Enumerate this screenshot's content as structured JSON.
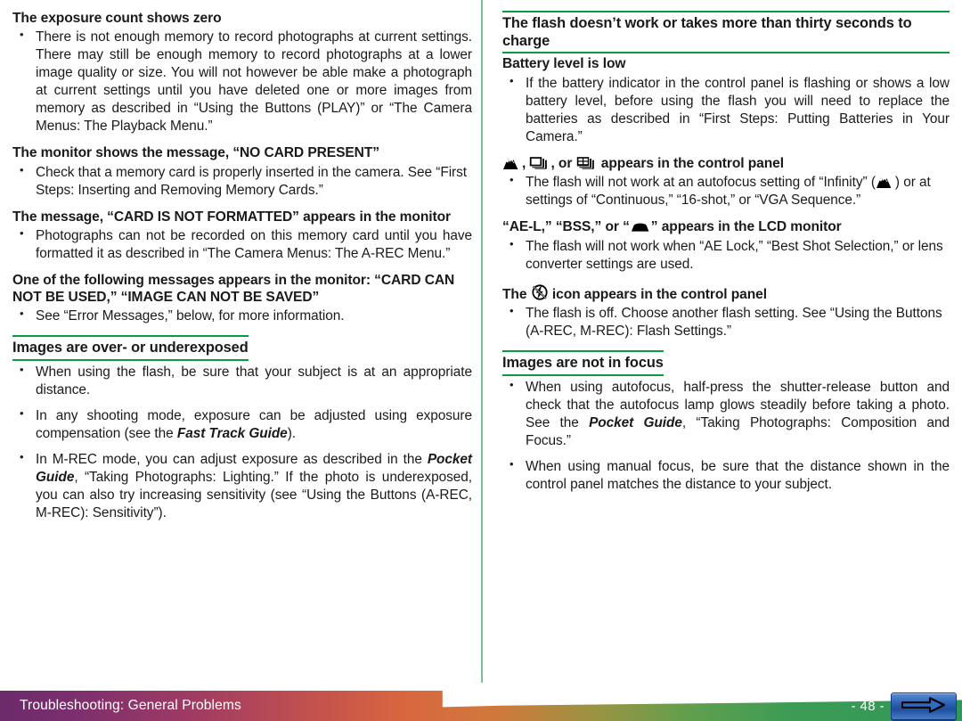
{
  "page": {
    "number_label": "- 48 -",
    "footer_title": "Troubleshooting: General Problems",
    "accent_green": "#0a9a3f",
    "divider_green": "#7fbf92"
  },
  "left_column": {
    "sections": [
      {
        "heading": "The exposure count shows zero",
        "heading_style": "plain",
        "bullets": [
          "There is not enough memory to record photographs at current settings. There may still be enough memory to record photographs at a lower image quality or size.  You will not however be able make a photograph at current settings until you have deleted one or more images from memory as described in “Using the Buttons (PLAY)” or “The Camera Menus: The Playback Menu.”"
        ]
      },
      {
        "heading": "The monitor shows the message, “NO CARD PRESENT”",
        "heading_style": "plain",
        "bullets": [
          "Check that a memory card is properly inserted in the camera. See “First Steps: Inserting and Removing Memory Cards.”"
        ]
      },
      {
        "heading": "The message, “CARD IS NOT FORMATTED” appears in the monitor",
        "heading_style": "plain",
        "bullets": [
          "Photographs can not be recorded on this memory card until you have formatted it as described in “The Camera Menus: The A-REC Menu.”"
        ]
      },
      {
        "heading": "One of the following messages appears in the monitor: “CARD CAN NOT BE USED,” “IMAGE CAN NOT BE SAVED”",
        "heading_style": "plain",
        "bullets": [
          "See “Error Messages,” below, for more information."
        ]
      },
      {
        "heading": "Images are over- or underexposed",
        "heading_style": "major",
        "bullets": [
          "When using the flash, be sure that your subject is at an appropriate distance.",
          "In any shooting mode, exposure can be adjusted using exposure compensation (see the Fast Track Guide).",
          "In M-REC mode, you can adjust exposure as described in the Pocket Guide, “Taking Photographs: Lighting.”  If the photo is underexposed, you can also try increasing sensitivity (see “Using the Buttons (A-REC, M-REC): Sensitivity”)."
        ]
      }
    ],
    "bullet_parts": {
      "exposure_comp_pre": "In any shooting mode, exposure can be adjusted using exposure compensation (see the ",
      "exposure_comp_italic": "Fast Track Guide",
      "exposure_comp_post": ").",
      "mrec_pre": "In M-REC mode, you can adjust exposure as described in the ",
      "mrec_italic": "Pocket Guide",
      "mrec_post": ", “Taking Photographs: Lighting.”  If the photo is underexposed, you can also try increasing sensitivity (see “Using the Buttons (A-REC, M-REC): Sensitivity”)."
    }
  },
  "right_column": {
    "major_heading": "The flash doesn’t work or takes more than thirty seconds to charge",
    "sections": [
      {
        "heading": "Battery level is low",
        "bullets": [
          "If the battery indicator in the control panel is flashing or shows a low battery level, before using the flash you will need to replace the batteries as described in “First Steps: Putting Batteries in Your Camera.”"
        ]
      }
    ],
    "icon_heading_1": {
      "sep1": ", ",
      "sep2": ", or ",
      "tail": " appears in the control panel",
      "icons": [
        "mountain-infinity-icon",
        "continuous-shooting-icon",
        "vga-sequence-icon"
      ],
      "bullet_pre": "The flash will not work at an autofocus setting of “Infinity” (",
      "bullet_post": ") or at settings of “Continuous,” “16-shot,” or “VGA Sequence.”"
    },
    "icon_heading_2": {
      "pre": "“AE-L,” “BSS,” or “",
      "post": "” appears in the LCD monitor",
      "icon": "lens-converter-icon",
      "bullet": "The flash will not work when “AE Lock,” “Best Shot Selection,” or lens converter settings are used."
    },
    "icon_heading_3": {
      "pre": "The ",
      "post": " icon appears in the control panel",
      "icon": "flash-off-icon",
      "bullet": "The flash is off.  Choose another flash setting.  See “Using the Buttons (A-REC, M-REC): Flash Settings.”"
    },
    "focus_section": {
      "heading": "Images are not in focus",
      "bullet1_pre": "When using autofocus, half-press the shutter-release button and check that the autofocus lamp glows steadily before taking a photo.  See the ",
      "bullet1_italic": "Pocket Guide",
      "bullet1_post": ", “Taking Photographs: Composition and Focus.”",
      "bullet2": "When using manual focus, be sure that the distance shown in the control panel matches the distance to your subject."
    }
  }
}
